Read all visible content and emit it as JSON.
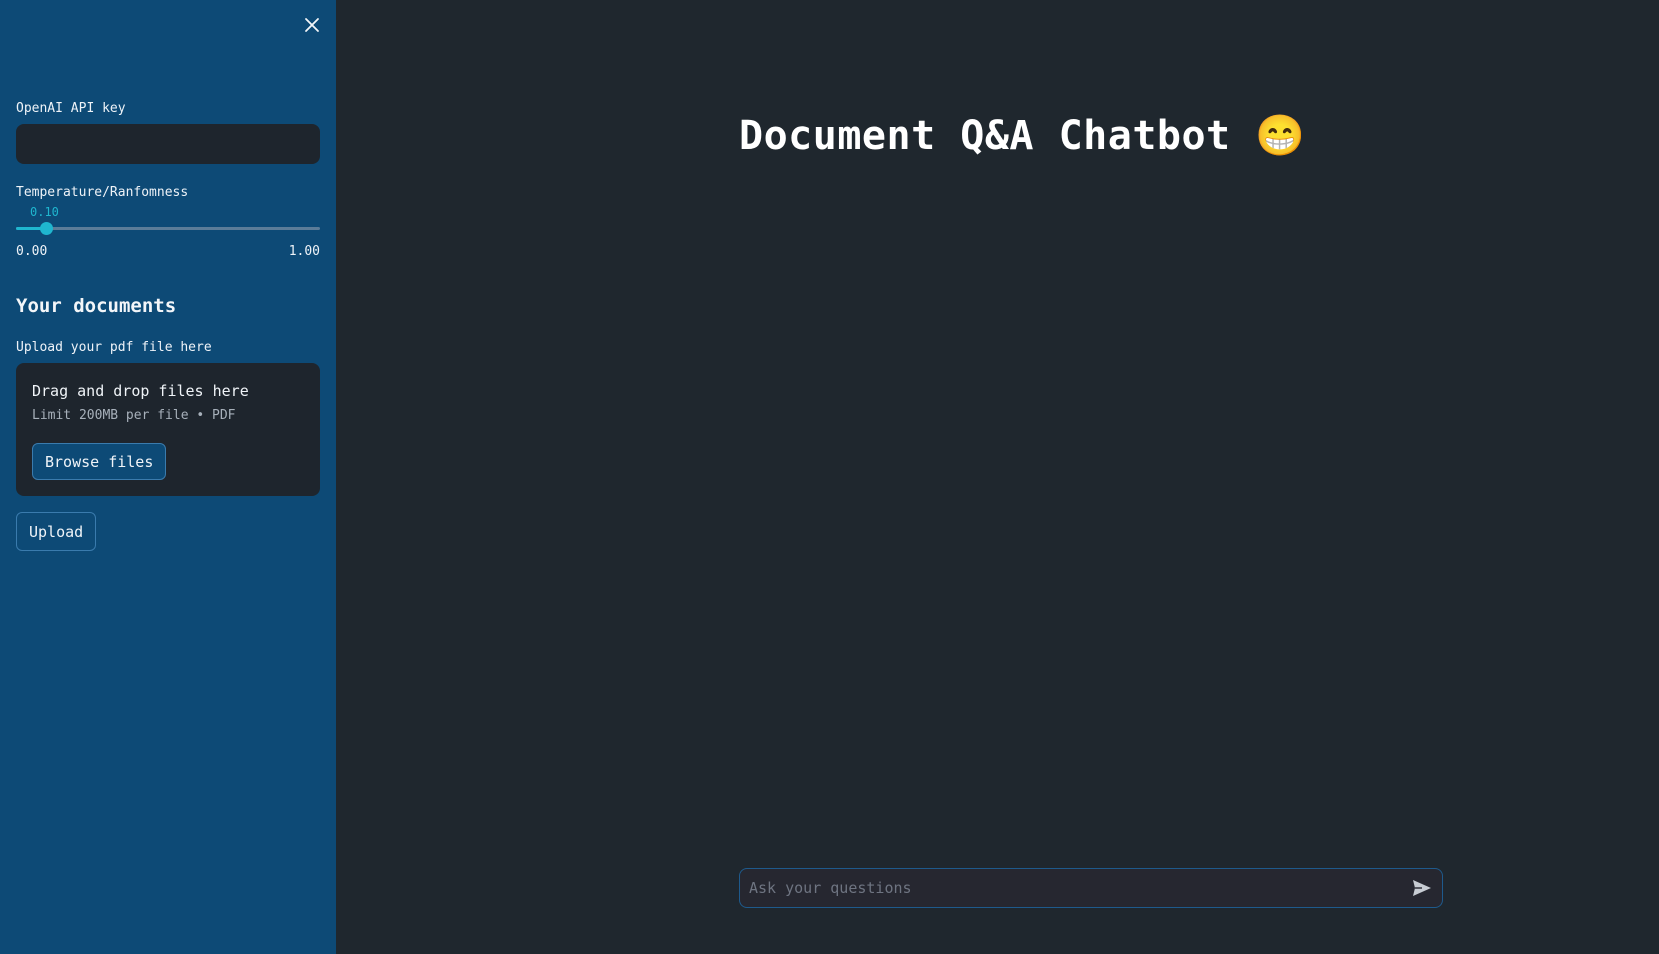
{
  "sidebar": {
    "api_key_label": "OpenAI API key",
    "api_key_value": "",
    "temperature_label": "Temperature/Ranfomness",
    "temperature": {
      "value": 0.1,
      "value_text": "0.10",
      "min_text": "0.00",
      "max_text": "1.00",
      "min": 0,
      "max": 1
    },
    "documents_heading": "Your documents",
    "upload_label": "Upload your pdf file here",
    "dropzone": {
      "title": "Drag and drop files here",
      "subtitle": "Limit 200MB per file • PDF",
      "browse_label": "Browse files"
    },
    "upload_button": "Upload"
  },
  "main": {
    "title": "Document Q&A Chatbot 😁",
    "chat_placeholder": "Ask your questions"
  },
  "icons": {
    "close": "close-icon",
    "send": "send-icon"
  },
  "colors": {
    "sidebar_bg": "#0d4a76",
    "main_bg": "#1f272e",
    "accent": "#1fb6cf"
  }
}
